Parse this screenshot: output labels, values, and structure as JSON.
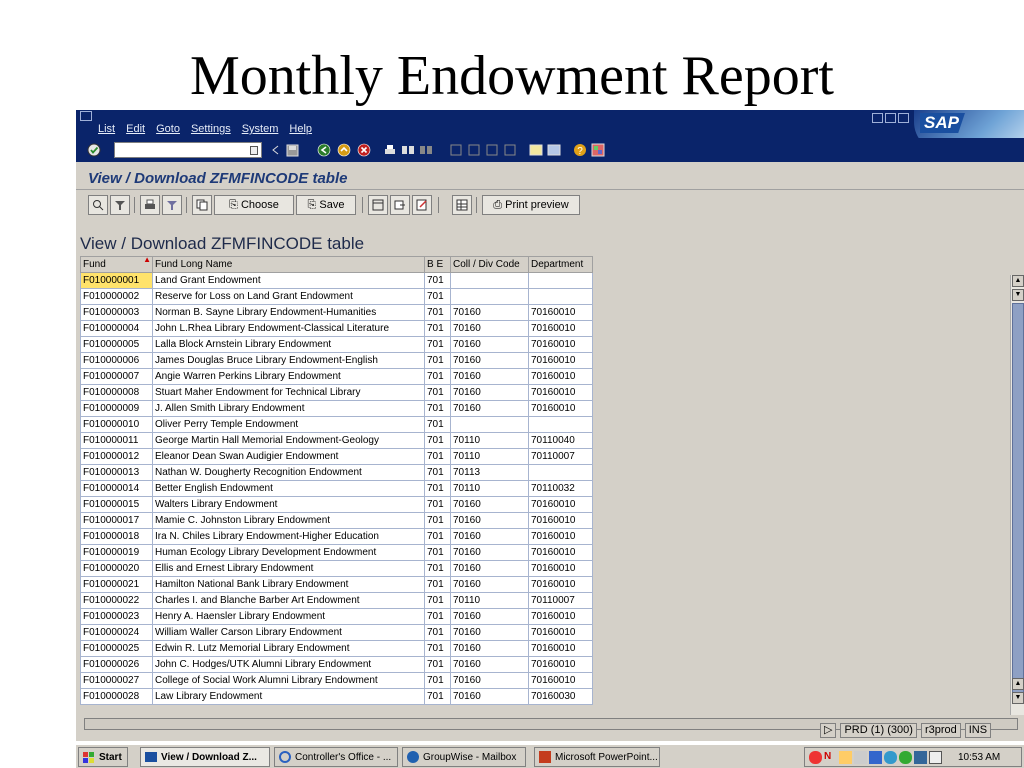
{
  "slide": {
    "title": "Monthly Endowment Report"
  },
  "menubar": {
    "items": [
      "List",
      "Edit",
      "Goto",
      "Settings",
      "System",
      "Help"
    ],
    "logo": "SAP"
  },
  "transaction": {
    "title": "View / Download ZFMFINCODE table"
  },
  "app_toolbar": {
    "choose_label": "Choose",
    "save_label": "Save",
    "print_preview_label": "Print preview"
  },
  "list": {
    "heading": "View / Download ZFMFINCODE table",
    "columns": [
      "Fund",
      "Fund Long Name",
      "B E",
      "Coll / Div Code",
      "Department"
    ],
    "rows": [
      [
        "F010000001",
        "Land Grant Endowment",
        "701",
        "",
        ""
      ],
      [
        "F010000002",
        "Reserve for Loss on Land Grant Endowment",
        "701",
        "",
        ""
      ],
      [
        "F010000003",
        "Norman B. Sayne Library Endowment-Humanities",
        "701",
        "70160",
        "70160010"
      ],
      [
        "F010000004",
        "John L.Rhea Library Endowment-Classical Literature",
        "701",
        "70160",
        "70160010"
      ],
      [
        "F010000005",
        "Lalla Block Arnstein Library Endowment",
        "701",
        "70160",
        "70160010"
      ],
      [
        "F010000006",
        "James Douglas Bruce Library Endowment-English",
        "701",
        "70160",
        "70160010"
      ],
      [
        "F010000007",
        "Angie Warren Perkins Library Endowment",
        "701",
        "70160",
        "70160010"
      ],
      [
        "F010000008",
        "Stuart Maher Endowment for Technical Library",
        "701",
        "70160",
        "70160010"
      ],
      [
        "F010000009",
        "J. Allen Smith Library Endowment",
        "701",
        "70160",
        "70160010"
      ],
      [
        "F010000010",
        "Oliver Perry Temple Endowment",
        "701",
        "",
        ""
      ],
      [
        "F010000011",
        "George Martin Hall Memorial Endowment-Geology",
        "701",
        "70110",
        "70110040"
      ],
      [
        "F010000012",
        "Eleanor Dean Swan Audigier Endowment",
        "701",
        "70110",
        "70110007"
      ],
      [
        "F010000013",
        "Nathan W. Dougherty Recognition Endowment",
        "701",
        "70113",
        ""
      ],
      [
        "F010000014",
        "Better English Endowment",
        "701",
        "70110",
        "70110032"
      ],
      [
        "F010000015",
        "Walters Library Endowment",
        "701",
        "70160",
        "70160010"
      ],
      [
        "F010000017",
        "Mamie C. Johnston Library Endowment",
        "701",
        "70160",
        "70160010"
      ],
      [
        "F010000018",
        "Ira N. Chiles Library Endowment-Higher Education",
        "701",
        "70160",
        "70160010"
      ],
      [
        "F010000019",
        "Human Ecology Library Development Endowment",
        "701",
        "70160",
        "70160010"
      ],
      [
        "F010000020",
        "Ellis and Ernest Library Endowment",
        "701",
        "70160",
        "70160010"
      ],
      [
        "F010000021",
        "Hamilton National Bank Library Endowment",
        "701",
        "70160",
        "70160010"
      ],
      [
        "F010000022",
        "Charles I. and Blanche Barber Art Endowment",
        "701",
        "70110",
        "70110007"
      ],
      [
        "F010000023",
        "Henry A. Haensler Library Endowment",
        "701",
        "70160",
        "70160010"
      ],
      [
        "F010000024",
        "William Waller Carson Library Endowment",
        "701",
        "70160",
        "70160010"
      ],
      [
        "F010000025",
        "Edwin R. Lutz Memorial Library Endowment",
        "701",
        "70160",
        "70160010"
      ],
      [
        "F010000026",
        "John C. Hodges/UTK Alumni Library Endowment",
        "701",
        "70160",
        "70160010"
      ],
      [
        "F010000027",
        "College of Social Work Alumni Library Endowment",
        "701",
        "70160",
        "70160010"
      ],
      [
        "F010000028",
        "Law Library Endowment",
        "701",
        "70160",
        "70160030"
      ]
    ]
  },
  "statusbar": {
    "system": "PRD (1) (300)",
    "server": "r3prod",
    "mode": "INS"
  },
  "taskbar": {
    "start_label": "Start",
    "tasks": [
      "View / Download Z...",
      "Controller's Office - ...",
      "GroupWise - Mailbox",
      "Microsoft PowerPoint..."
    ],
    "clock": "10:53 AM"
  },
  "colors": {
    "menubar_bg": "#0a246a",
    "window_bg": "#d4d0c8",
    "title_text": "#1e3a78",
    "selected_cell": "#ffe36b"
  },
  "icons": [
    "system-menu-icon",
    "enter-icon",
    "back-icon",
    "exit-icon",
    "cancel-icon",
    "print-icon",
    "find-icon",
    "help-icon",
    "sap-logo"
  ]
}
